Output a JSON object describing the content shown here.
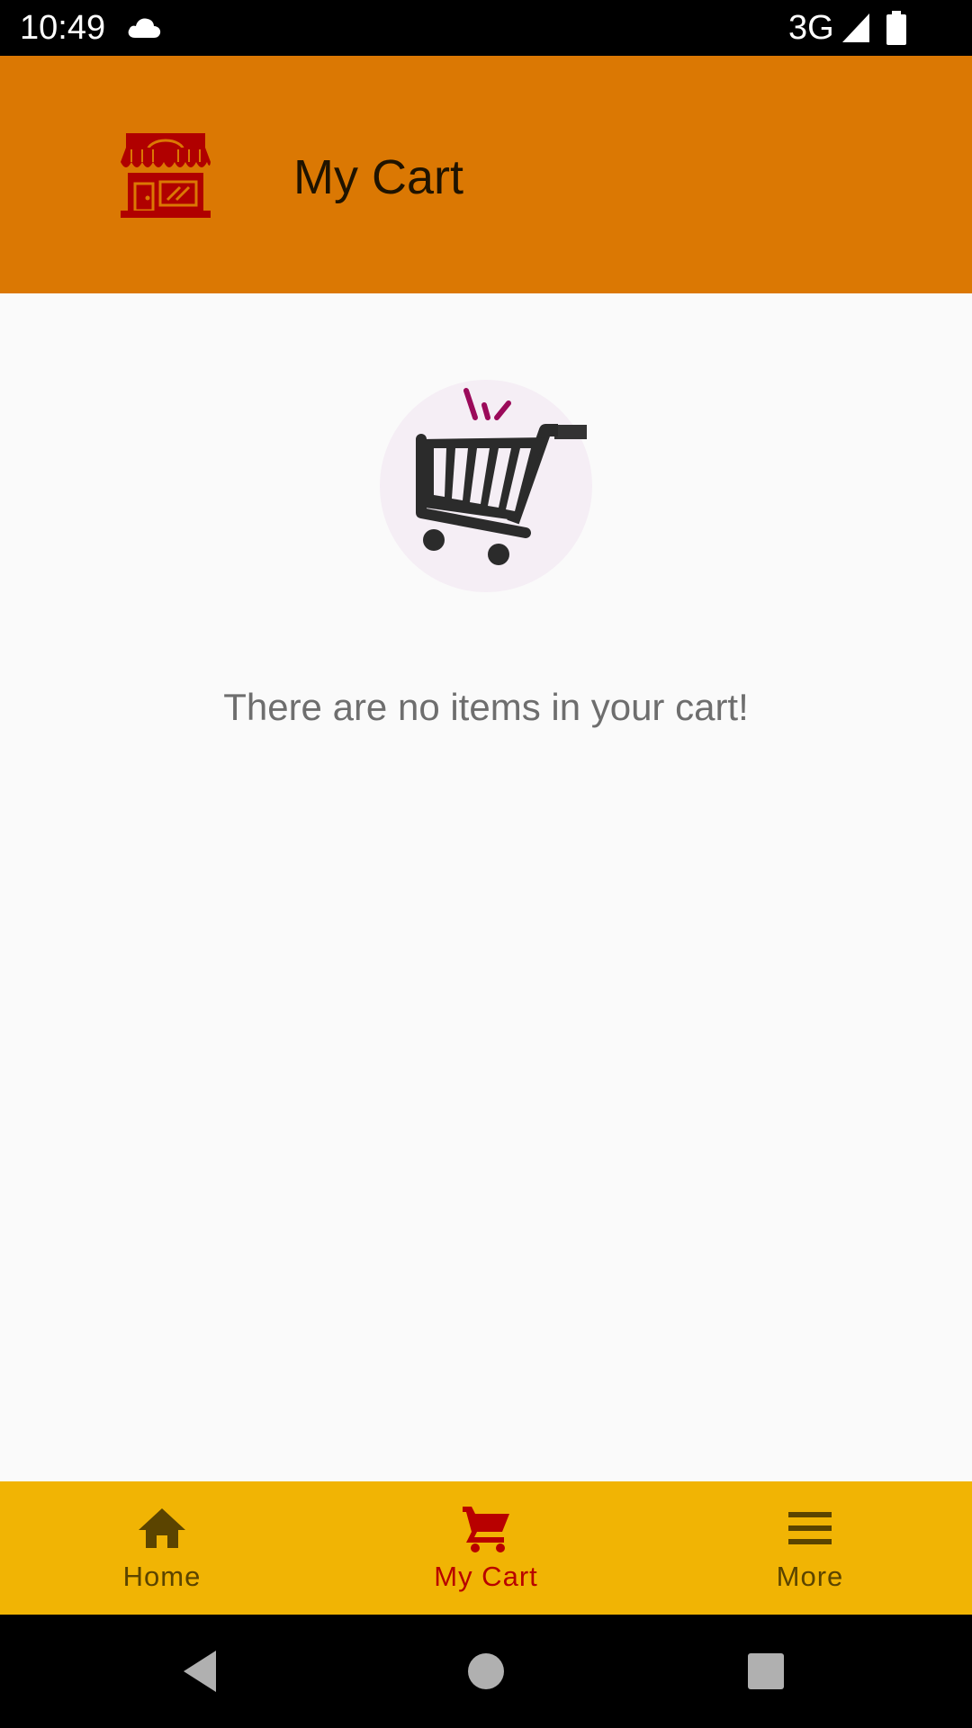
{
  "status_bar": {
    "time": "10:49",
    "network": "3G",
    "icons": [
      "cloud-icon",
      "signal-icon",
      "battery-icon"
    ]
  },
  "app_bar": {
    "title": "My Cart",
    "logo_icon": "store-icon",
    "background_color": "#db7803",
    "logo_color": "#b00000"
  },
  "empty_state": {
    "icon": "shopping-cart-illustration",
    "message": "There are no items in your cart!"
  },
  "bottom_nav": {
    "background_color": "#f1b404",
    "active_color": "#b80000",
    "inactive_color": "#5b4400",
    "items": [
      {
        "label": "Home",
        "icon": "home-icon",
        "active": false
      },
      {
        "label": "My Cart",
        "icon": "cart-icon",
        "active": true
      },
      {
        "label": "More",
        "icon": "menu-icon",
        "active": false
      }
    ]
  },
  "system_nav": {
    "buttons": [
      "back-icon",
      "home-circle-icon",
      "recents-icon"
    ]
  }
}
